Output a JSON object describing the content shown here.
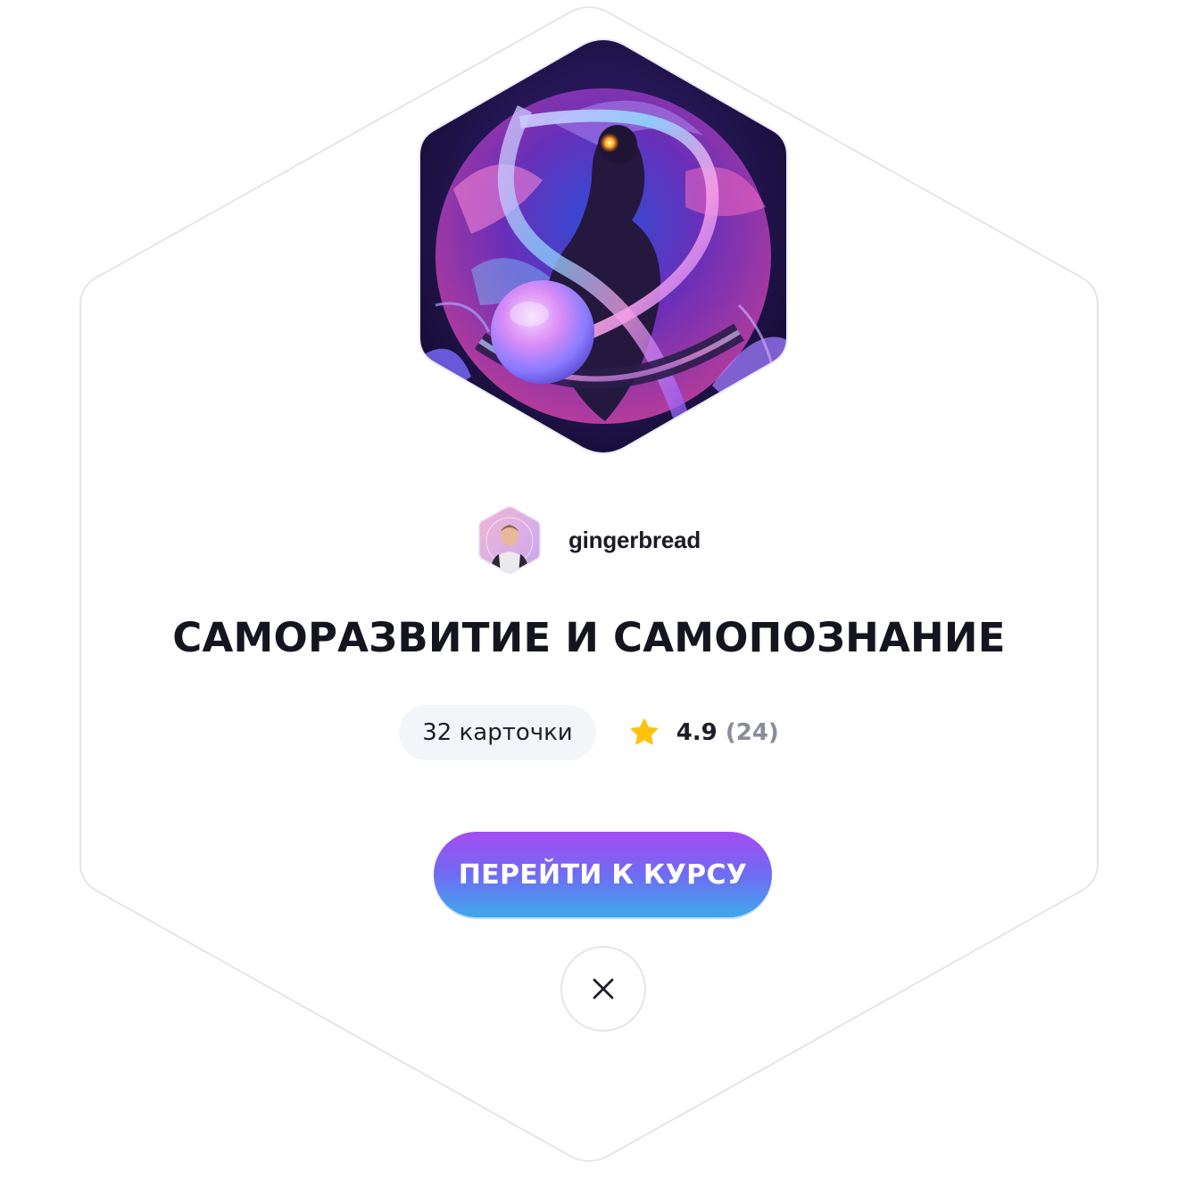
{
  "author": {
    "name": "gingerbread"
  },
  "course": {
    "title": "САМОРАЗВИТИЕ И САМОПОЗНАНИЕ",
    "cards_label": "32 карточки",
    "rating": "4.9",
    "rating_count": "(24)"
  },
  "actions": {
    "go_to_course": "ПЕРЕЙТИ К КУРСУ",
    "close_icon": "close-icon"
  },
  "colors": {
    "button_gradient_top": "#a44cf3",
    "button_gradient_bottom": "#3ea9ec",
    "star": "#ffc20e",
    "title": "#15151f",
    "muted": "#8a8d99",
    "pill_bg": "#f3f5f8",
    "outline": "#e4e5ea"
  }
}
